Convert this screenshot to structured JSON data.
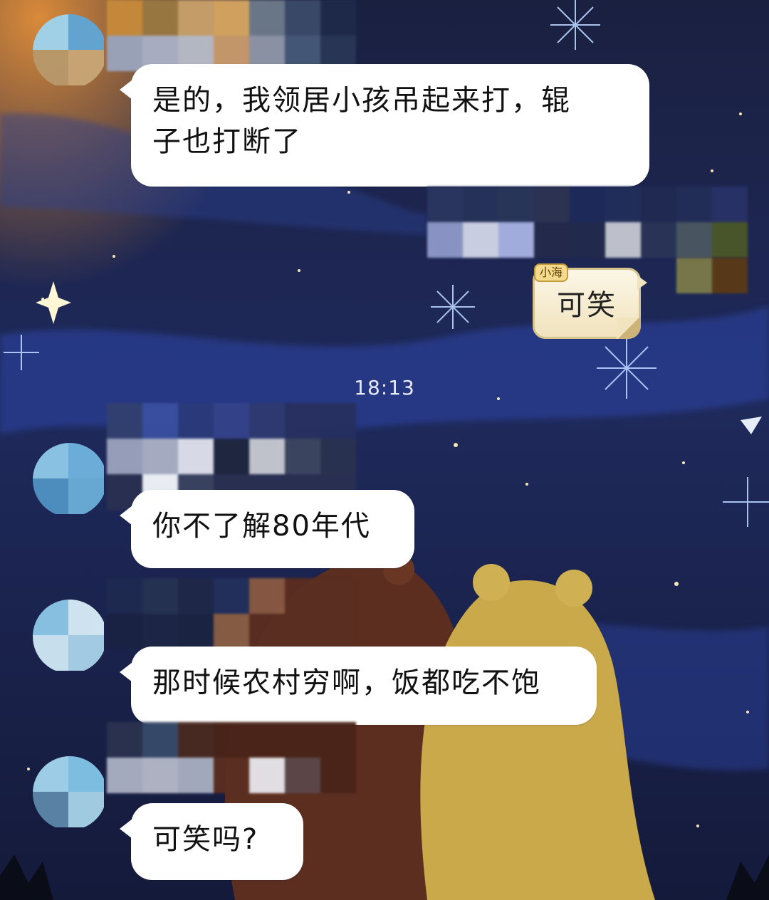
{
  "colors": {
    "sky_top": "#1c2447",
    "sky_mid": "#223068",
    "bubble": "#ffffff",
    "bear_brown": "#5b2e20",
    "bear_yellow": "#c9a94a"
  },
  "messages": [
    {
      "side": "left",
      "text": "是的，我领居小孩吊起来打，辊\n子也打断了"
    },
    {
      "side": "right",
      "text": "可笑",
      "sender_tag": "小海"
    },
    {
      "side": "left",
      "text": "你不了解80年代"
    },
    {
      "side": "left",
      "text": "那时候农村穷啊，饭都吃不饱"
    },
    {
      "side": "left",
      "text": "可笑吗?"
    }
  ],
  "timestamp": "18:13",
  "icons": {
    "avatar": "avatar-blurred-icon",
    "name": "name-blurred-icon"
  }
}
